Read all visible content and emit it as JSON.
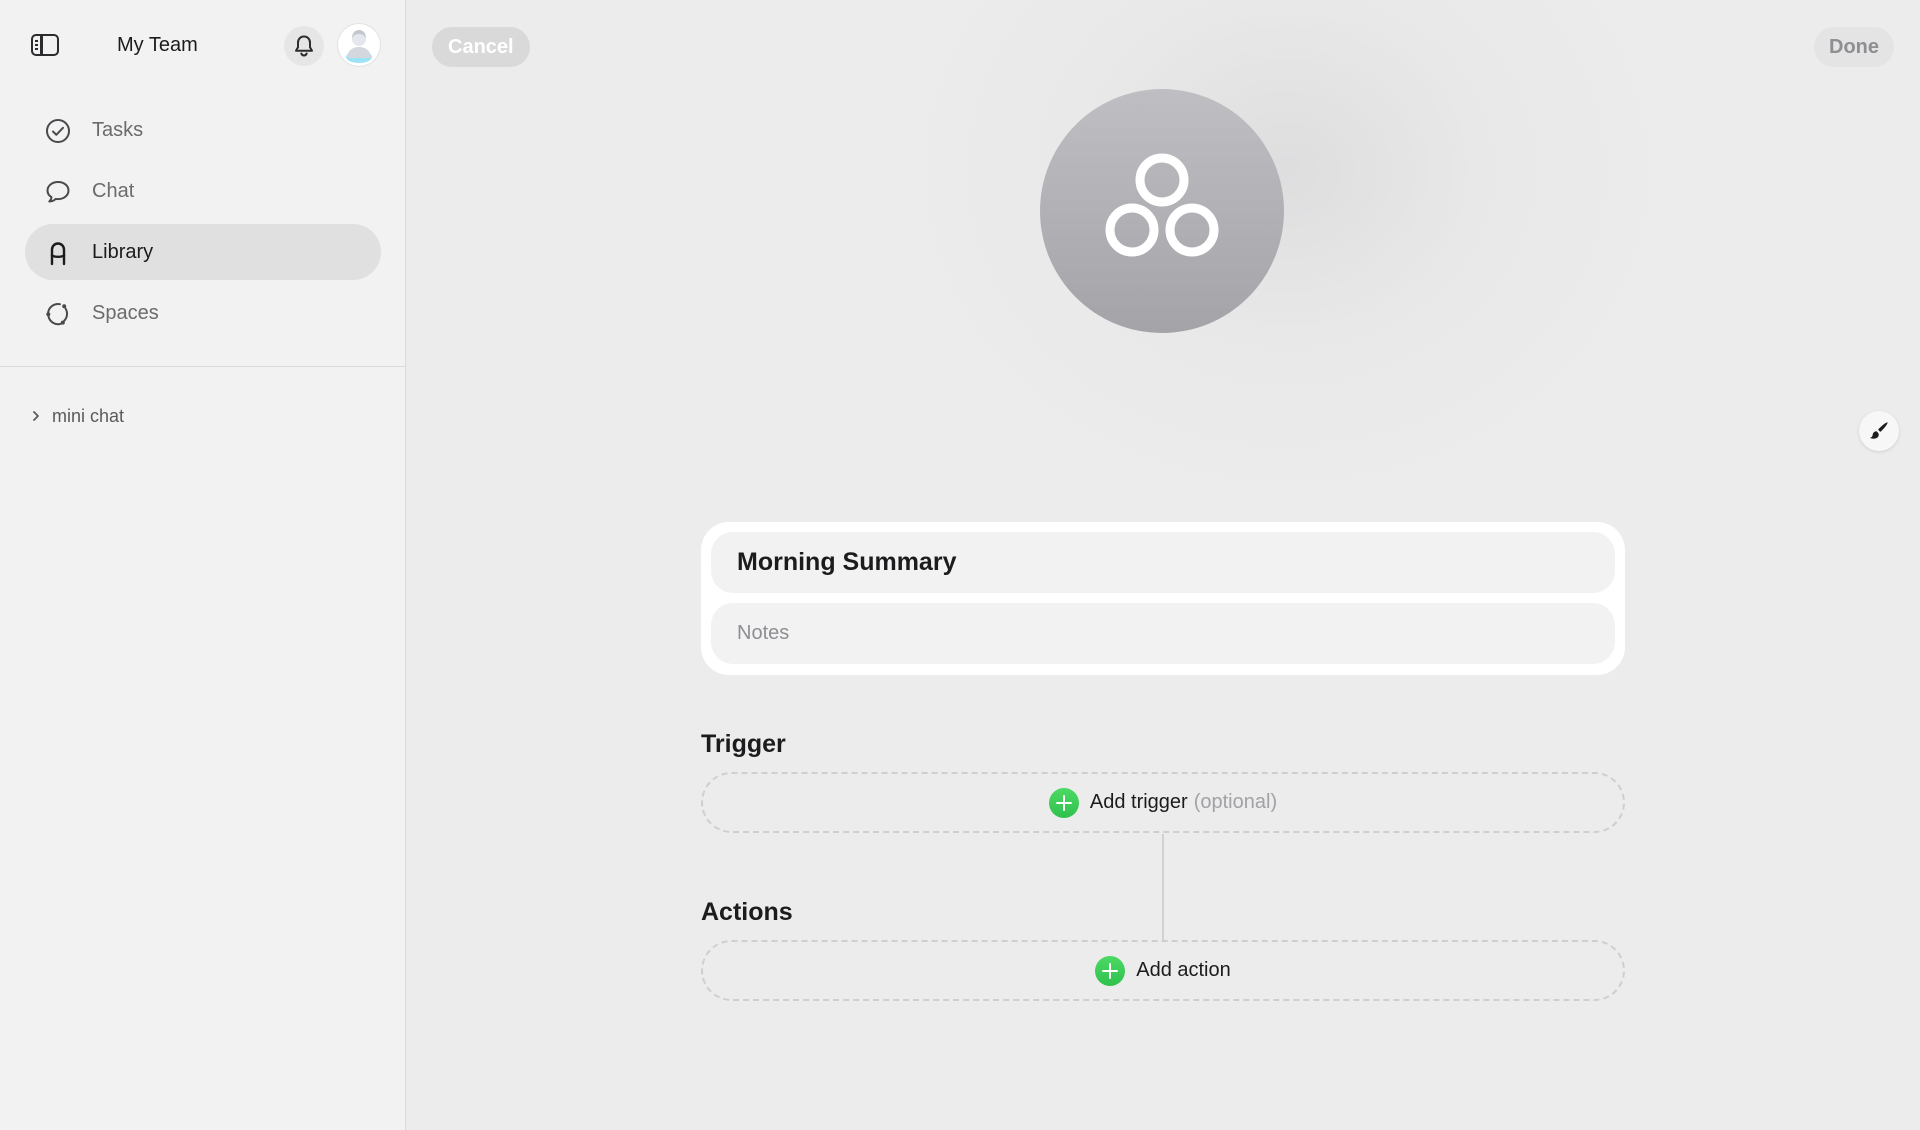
{
  "sidebar": {
    "title": "My Team",
    "items": [
      {
        "label": "Tasks",
        "icon": "checkmark-circle-icon",
        "active": false
      },
      {
        "label": "Chat",
        "icon": "chat-bubble-icon",
        "active": false
      },
      {
        "label": "Library",
        "icon": "library-icon",
        "active": true
      },
      {
        "label": "Spaces",
        "icon": "spaces-icon",
        "active": false
      }
    ],
    "mini_chat_label": "mini chat"
  },
  "toolbar": {
    "cancel_label": "Cancel",
    "done_label": "Done"
  },
  "shortcut": {
    "icon": "shortcuts-three-circles-icon",
    "title": "Morning Summary",
    "notes_placeholder": "Notes"
  },
  "trigger": {
    "heading": "Trigger",
    "add_label": "Add trigger",
    "optional_label": "(optional)"
  },
  "actions": {
    "heading": "Actions",
    "add_label": "Add action"
  },
  "colors": {
    "accent_green": "#34c759",
    "sidebar_bg": "#f2f2f2",
    "main_bg": "#ececec",
    "icon_circle": "#a4a4a8"
  }
}
